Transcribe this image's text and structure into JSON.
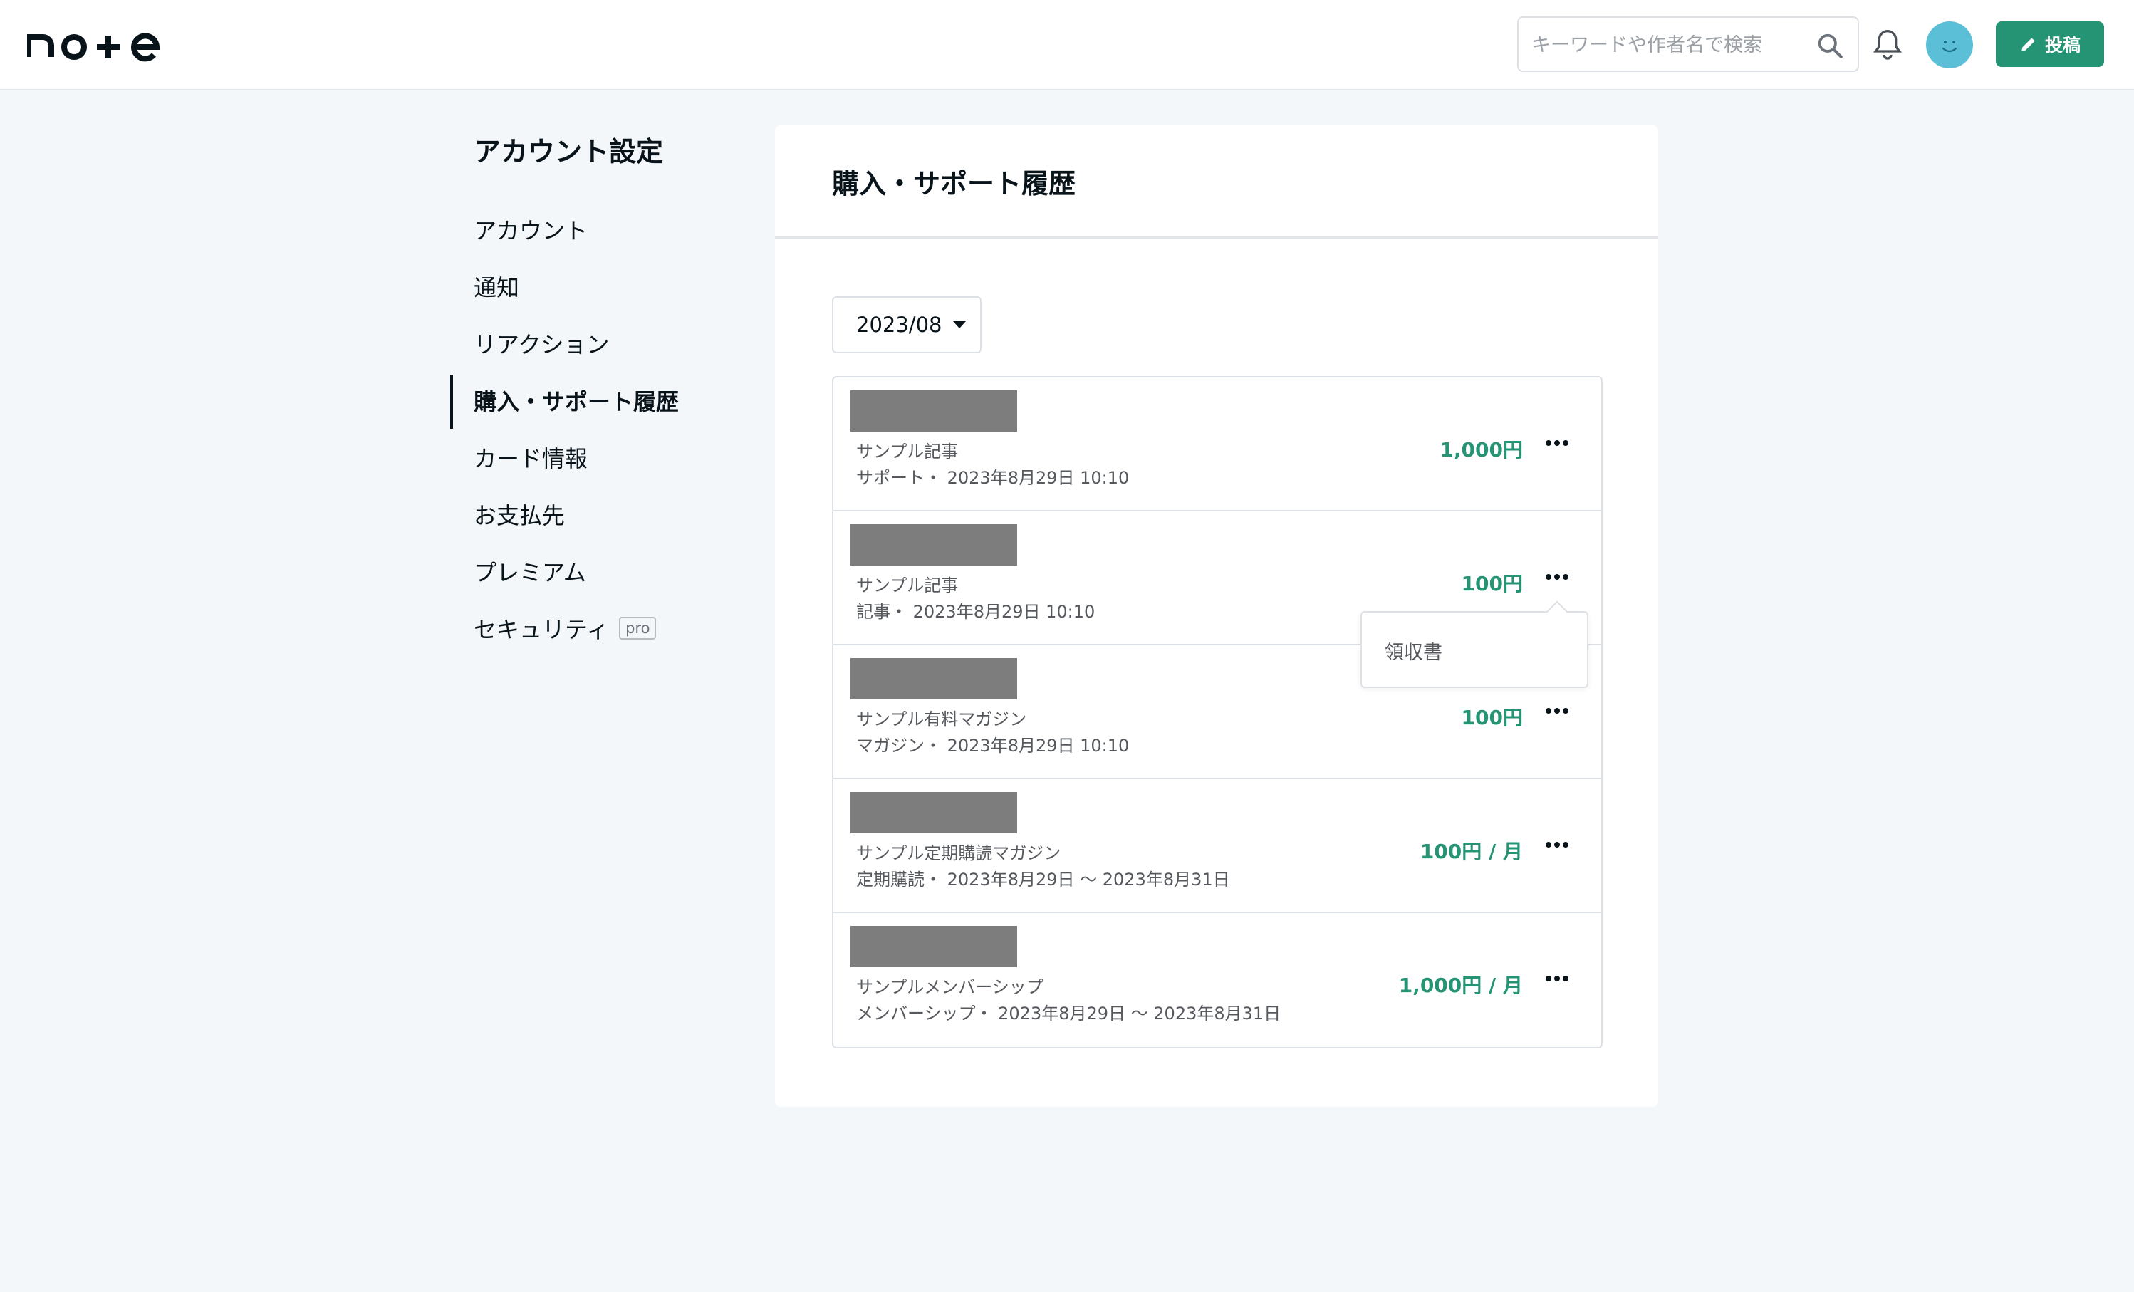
{
  "header": {
    "logo_text": "note",
    "search_placeholder": "キーワードや作者名で検索",
    "post_button_label": "投稿",
    "accent_color": "#249474"
  },
  "sidebar": {
    "title": "アカウント設定",
    "items": [
      {
        "label": "アカウント",
        "active": false
      },
      {
        "label": "通知",
        "active": false
      },
      {
        "label": "リアクション",
        "active": false
      },
      {
        "label": "購入・サポート履歴",
        "active": true
      },
      {
        "label": "カード情報",
        "active": false
      },
      {
        "label": "お支払先",
        "active": false
      },
      {
        "label": "プレミアム",
        "active": false
      },
      {
        "label": "セキュリティ",
        "badge": "pro",
        "active": false
      }
    ]
  },
  "main": {
    "title": "購入・サポート履歴",
    "month_select": "2023/08",
    "rows": [
      {
        "title": "サンプル記事",
        "meta": "サポート・ 2023年8月29日 10:10",
        "price": "1,000円"
      },
      {
        "title": "サンプル記事",
        "meta": "記事・ 2023年8月29日 10:10",
        "price": "100円"
      },
      {
        "title": "サンプル有料マガジン",
        "meta": "マガジン・ 2023年8月29日 10:10",
        "price": "100円"
      },
      {
        "title": "サンプル定期購読マガジン",
        "meta": "定期購読・ 2023年8月29日 〜 2023年8月31日",
        "price": "100円 / 月"
      },
      {
        "title": "サンプルメンバーシップ",
        "meta": "メンバーシップ・ 2023年8月29日 〜 2023年8月31日",
        "price": "1,000円 / 月"
      }
    ],
    "popup_item": "領収書"
  }
}
